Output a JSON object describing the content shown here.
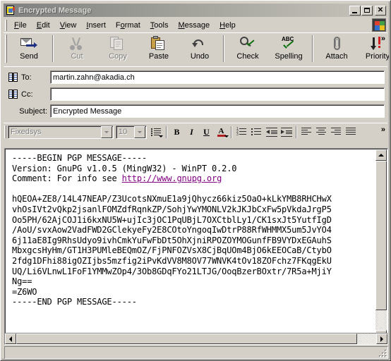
{
  "window": {
    "title": "Encrypted Message",
    "icon": "message-document-icon",
    "minimize_label": "Minimize",
    "maximize_label": "Maximize",
    "close_label": "Close"
  },
  "menu": {
    "items": [
      {
        "label": "File",
        "accel": "F"
      },
      {
        "label": "Edit",
        "accel": "E"
      },
      {
        "label": "View",
        "accel": "V"
      },
      {
        "label": "Insert",
        "accel": "I"
      },
      {
        "label": "Format",
        "accel": "o"
      },
      {
        "label": "Tools",
        "accel": "T"
      },
      {
        "label": "Message",
        "accel": "M"
      },
      {
        "label": "Help",
        "accel": "H"
      }
    ],
    "logo": "windows-flag-logo"
  },
  "toolbar": {
    "overflow_label": "»",
    "buttons": [
      {
        "label": "Send",
        "icon": "send-envelope-icon",
        "disabled": false
      },
      {
        "label": "Cut",
        "icon": "scissors-icon",
        "disabled": true
      },
      {
        "label": "Copy",
        "icon": "copy-sheets-icon",
        "disabled": true
      },
      {
        "label": "Paste",
        "icon": "clipboard-icon",
        "disabled": false
      },
      {
        "label": "Undo",
        "icon": "undo-arrow-icon",
        "disabled": false
      },
      {
        "label": "Check",
        "icon": "check-names-icon",
        "disabled": false
      },
      {
        "label": "Spelling",
        "icon": "spelling-abc-icon",
        "disabled": false
      },
      {
        "label": "Attach",
        "icon": "paperclip-icon",
        "disabled": false
      },
      {
        "label": "Priority",
        "icon": "priority-arrow-icon",
        "disabled": false
      }
    ]
  },
  "headers": {
    "to": {
      "label": "To:",
      "value": "martin.zahn@akadia.ch",
      "icon": "address-book-icon"
    },
    "cc": {
      "label": "Cc:",
      "value": "",
      "icon": "address-book-icon"
    },
    "subject": {
      "label": "Subject:",
      "value": "Encrypted Message"
    }
  },
  "formatbar": {
    "font_name": "Fixedsys",
    "font_size": "10",
    "overflow_label": "»",
    "buttons": [
      {
        "name": "paragraph-style",
        "glyph": "¶"
      },
      {
        "name": "bold",
        "glyph": "B"
      },
      {
        "name": "italic",
        "glyph": "I"
      },
      {
        "name": "underline",
        "glyph": "U"
      },
      {
        "name": "font-color",
        "glyph": "A"
      },
      {
        "name": "numbered-list",
        "glyph": ""
      },
      {
        "name": "bulleted-list",
        "glyph": ""
      },
      {
        "name": "decrease-indent",
        "glyph": ""
      },
      {
        "name": "increase-indent",
        "glyph": ""
      },
      {
        "name": "align-left",
        "glyph": ""
      },
      {
        "name": "align-center",
        "glyph": ""
      },
      {
        "name": "align-right",
        "glyph": ""
      },
      {
        "name": "justify",
        "glyph": ""
      }
    ]
  },
  "body": {
    "begin_marker": "-----BEGIN PGP MESSAGE-----",
    "version_line": "Version: GnuPG v1.0.5 (MingW32) - WinPT 0.2.0",
    "comment_prefix": "Comment: For info see ",
    "comment_link": "http://www.gnupg.org",
    "payload_lines": [
      "hQEOA+ZE8/14L47NEAP/Z3UcotsNXmuE1a9jQhycz66kiz5OaO+kLkYMB8RHCHwX",
      "vhOsIVt2vQkp2jsanlFOMZdfRqnkZP/SohjYwYMONLV2kJKJbCxFw5pVkdaJrgP5",
      "Oo5PH/62AjCOJ1i6kxNU5W+ujIc3jOC1PqUBjL7OXCtblLy1/CK1sxJt5YutfIgD",
      "/AoU/svxAow2VadFWD2GClekyeFy2E8COtoYngoqIwDtrP88RfWHMMX5um5JvYO4",
      "6j11aE8Ig9RhsUdyo9ivhCmkYuFwFbDt5OhXjniRPOZOYMOGunfFB9VYDxEGAuhS",
      "MbxgcsHyHm/GT1H3PUMleBEQmOZ/FjPNFOZVsX8CjBqUOm4BjO6kEEOCaB/CtybO",
      "2fdg1DFhi88igOZIjbs5mzfig2iPvKdVV8M8OV77WNVK4tOv18ZOFchz7FKqgEkU",
      "UQ/Li6VLnwL1FoF1YMMwZOp4/3Ob8GDqFYo21LTJG/OoqBzerBOxtr/7R5a+MjiY",
      "Ng==",
      "=Z6WO"
    ],
    "end_marker": "-----END PGP MESSAGE-----"
  },
  "scrollbars": {
    "vertical": {
      "up": "scroll-up",
      "down": "scroll-down"
    },
    "horizontal": {
      "left": "scroll-left",
      "right": "scroll-right"
    }
  },
  "statusbar": {
    "text": ""
  },
  "colors": {
    "window_face": "#d4d0c8",
    "link": "#800080",
    "title_gradient_start": "#808080",
    "title_gradient_end": "#c8c4bc",
    "disabled_text": "#808080"
  }
}
